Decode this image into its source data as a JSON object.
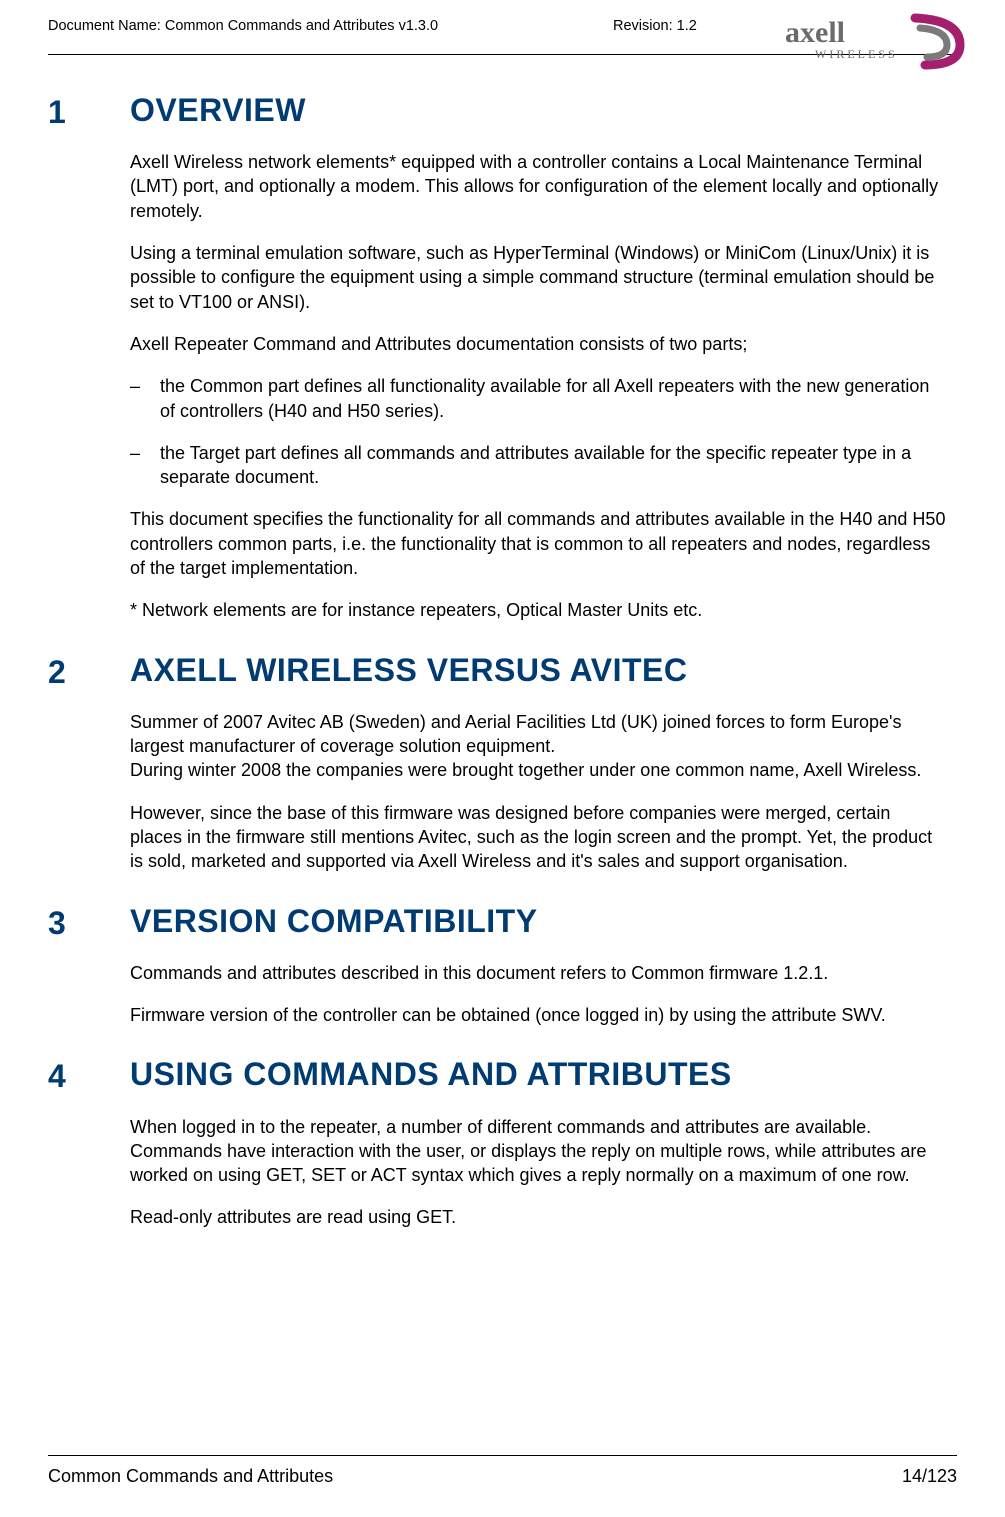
{
  "header": {
    "doc_name": "Document Name: Common Commands and Attributes v1.3.0",
    "revision": "Revision: 1.2",
    "logo_text_top": "axell",
    "logo_text_bottom": "WIRELESS"
  },
  "sections": [
    {
      "num": "1",
      "title": "OVERVIEW",
      "blocks": [
        {
          "type": "p",
          "text": "Axell Wireless network elements* equipped with a controller contains a Local Maintenance Terminal (LMT) port, and optionally a modem. This allows for configuration of the element locally and optionally remotely."
        },
        {
          "type": "p",
          "text": "Using a terminal emulation software, such as HyperTerminal (Windows) or MiniCom (Linux/Unix) it is possible to configure the equipment using a simple command structure (terminal emulation should be set to VT100 or ANSI)."
        },
        {
          "type": "p",
          "text": "Axell Repeater Command and Attributes documentation consists of two parts;"
        },
        {
          "type": "li",
          "text": "the Common part defines all functionality available for all Axell repeaters with the new generation of controllers (H40 and H50 series)."
        },
        {
          "type": "li",
          "text": "the Target part defines all commands and attributes available for the specific repeater  type in a separate document."
        },
        {
          "type": "p",
          "text": "This document specifies the functionality for all commands and attributes available in the H40 and H50 controllers common parts, i.e. the functionality that is common to all repeaters and nodes, regardless of the target implementation."
        },
        {
          "type": "p",
          "text": "* Network elements are for instance repeaters, Optical Master Units etc."
        }
      ]
    },
    {
      "num": "2",
      "title": "AXELL WIRELESS VERSUS AVITEC",
      "blocks": [
        {
          "type": "p",
          "text": "Summer of 2007 Avitec AB (Sweden) and Aerial Facilities Ltd (UK) joined forces to form Europe's largest manufacturer of coverage solution equipment.\nDuring winter 2008 the companies were brought together under one common name, Axell Wireless."
        },
        {
          "type": "p",
          "text": "However, since the base of this firmware was designed before companies were merged, certain places in the firmware still mentions Avitec, such as the login screen and the prompt. Yet, the product is sold, marketed and supported via Axell Wireless and it's sales and support organisation."
        }
      ]
    },
    {
      "num": "3",
      "title": "VERSION COMPATIBILITY",
      "blocks": [
        {
          "type": "p",
          "text": "Commands and attributes described in this document refers to Common firmware 1.2.1."
        },
        {
          "type": "p",
          "text": "Firmware version of the controller can be obtained (once logged in) by using the attribute SWV."
        }
      ]
    },
    {
      "num": "4",
      "title": "USING COMMANDS AND ATTRIBUTES",
      "blocks": [
        {
          "type": "p",
          "text": "When logged in to the repeater, a number of different commands and attributes are available. Commands have interaction with the user, or displays the reply on multiple rows, while attributes are worked on using GET, SET or ACT syntax which gives a reply normally on a maximum of one row."
        },
        {
          "type": "p",
          "text": "Read-only attributes are read using GET."
        }
      ]
    }
  ],
  "footer": {
    "title": "Common Commands and Attributes",
    "page": "14/123"
  }
}
